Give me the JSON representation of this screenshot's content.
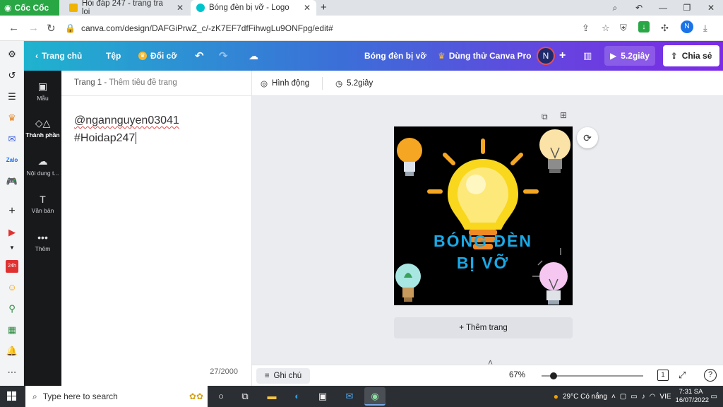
{
  "browser": {
    "brand": "Cốc Cốc",
    "tabs": [
      {
        "label": "Hỏi đáp 247 - trang tra loi",
        "active": false
      },
      {
        "label": "Bóng đèn bị vỡ - Logo",
        "active": true
      }
    ],
    "url": "canva.com/design/DAFGiPrwZ_c/-zK7EF7dfFihwgLu9ONFpg/edit#",
    "profile_initial": "N"
  },
  "canva": {
    "topbar": {
      "home": "Trang chủ",
      "file": "Tệp",
      "resize": "Đổi cỡ",
      "doc_title": "Bóng đèn bị vỡ",
      "trial": "Dùng thử Canva Pro",
      "avatar": "N",
      "present": "5.2giây",
      "share": "Chia sẻ"
    },
    "side": {
      "items": [
        "Mẫu",
        "Thành phần",
        "Nội dung t...",
        "Văn bản",
        "Thêm"
      ]
    },
    "notes": {
      "header_page": "Trang 1",
      "header_sep": " - ",
      "header_placeholder": "Thêm tiêu đề trang",
      "line1": "@ngannguyen03041",
      "line2": "#Hoidap247",
      "counter": "27/2000"
    },
    "toolbar": {
      "animate": "Hình động",
      "duration": "5.2giây"
    },
    "design": {
      "line1": "BÓNG ĐÈN",
      "line2": "BỊ VỠ",
      "text_color": "#1aa9e6",
      "bg_color": "#000000"
    },
    "add_page": "+ Thêm trang",
    "bottom": {
      "notes": "Ghi chú",
      "zoom": "67%",
      "zoom_level": 0.12,
      "page_count": "1"
    }
  },
  "taskbar": {
    "search_placeholder": "Type here to search",
    "weather": "29°C  Có nắng",
    "lang": "VIE",
    "time": "7:31 SA",
    "date": "16/07/2022"
  }
}
